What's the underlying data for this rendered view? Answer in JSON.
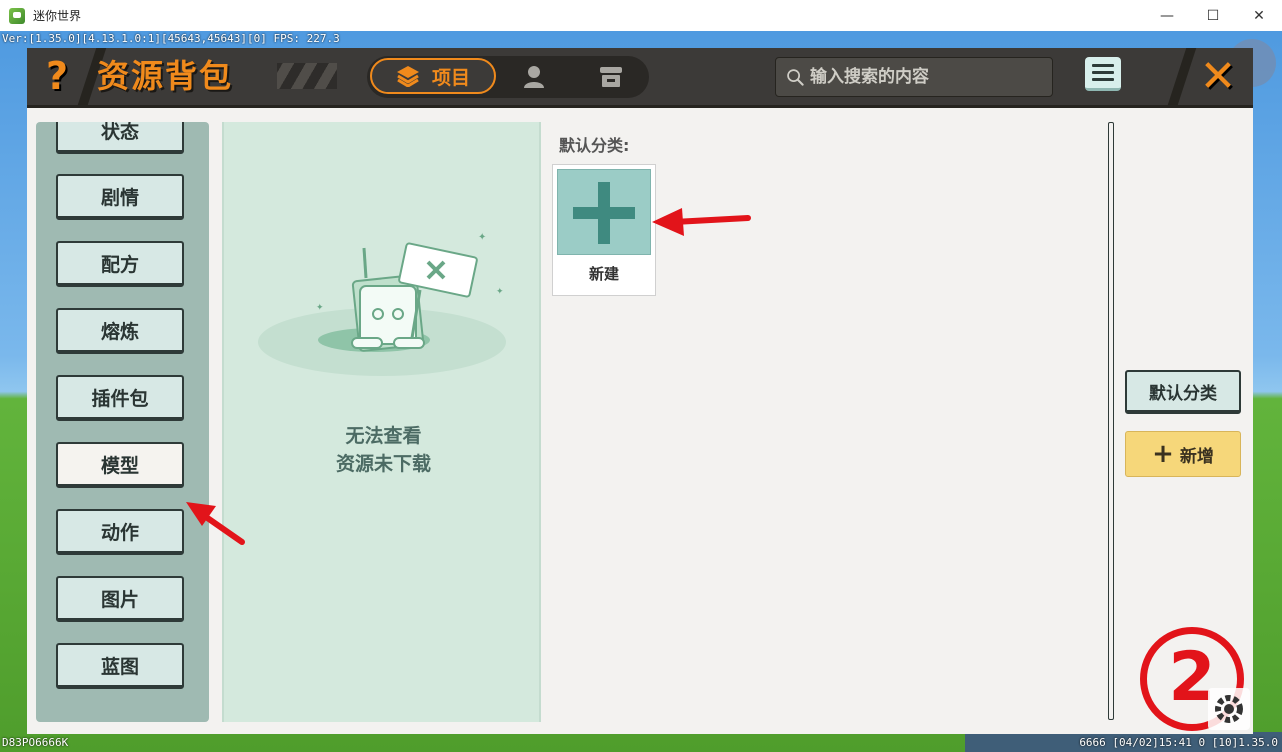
{
  "window": {
    "title": "迷你世界",
    "min_glyph": "—",
    "max_glyph": "☐",
    "close_glyph": "✕"
  },
  "hud": {
    "version_line": "Ver:[1.35.0][4.13.1.0:1][45643,45643][0] FPS: 227.3",
    "bottom_left": "D83PO6666K",
    "bottom_right": "6666  [04/02]15:41 0  [10]1.35.0"
  },
  "header": {
    "help_glyph": "?",
    "title": "资源背包",
    "tab_project_label": "项目",
    "search_placeholder": "输入搜索的内容",
    "close_glyph": "✕"
  },
  "categories": [
    {
      "label": "状态",
      "active": false
    },
    {
      "label": "剧情",
      "active": false
    },
    {
      "label": "配方",
      "active": false
    },
    {
      "label": "熔炼",
      "active": false
    },
    {
      "label": "插件包",
      "active": false
    },
    {
      "label": "模型",
      "active": true
    },
    {
      "label": "动作",
      "active": false
    },
    {
      "label": "图片",
      "active": false
    },
    {
      "label": "蓝图",
      "active": false
    }
  ],
  "empty_state": {
    "line1": "无法查看",
    "line2": "资源未下载"
  },
  "content": {
    "group_label": "默认分类:",
    "new_card_label": "新建"
  },
  "sidebar": {
    "default_category": "默认分类",
    "add_label": "新增",
    "add_glyph": "+"
  },
  "annotations": {
    "step_number": "2"
  },
  "colors": {
    "accent_orange": "#f08a1c",
    "header_dark": "#3c3a38",
    "panel_green": "#9fbab2",
    "annotation_red": "#e2141a",
    "add_yellow": "#f6d77a"
  }
}
